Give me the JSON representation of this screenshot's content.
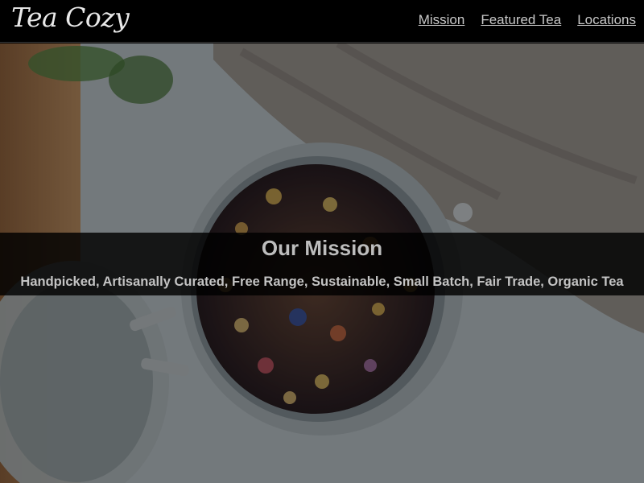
{
  "header": {
    "logo_text": "Tea Cozy",
    "nav": [
      {
        "label": "Mission"
      },
      {
        "label": "Featured Tea"
      },
      {
        "label": "Locations"
      }
    ]
  },
  "hero": {
    "image": "tea-jar-photo",
    "mission_title": "Our Mission",
    "mission_text": "Handpicked, Artisanally Curated, Free Range, Sustainable, Small Batch, Fair Trade, Organic Tea"
  },
  "colors": {
    "header_bg": "#000000",
    "nav_link": "#c8c8c8",
    "overlay": "rgba(0,0,0,0.82)"
  }
}
